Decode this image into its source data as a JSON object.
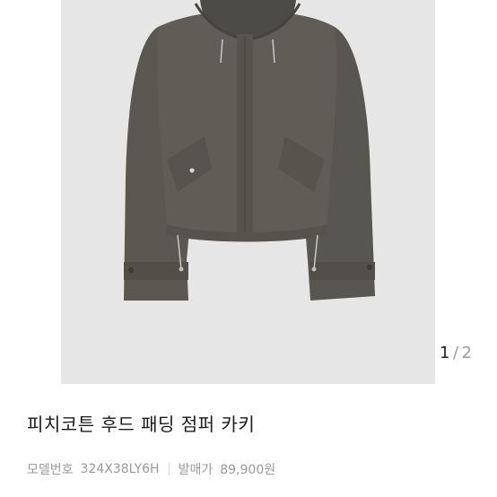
{
  "product": {
    "title": "피치코튼 후드 패딩 점퍼 카키",
    "model_label": "모델번호",
    "model_number": "324X38LY6H",
    "price_label": "발매가",
    "price": "89,900원",
    "image_subject": "khaki hooded cropped padded jacket"
  },
  "pager": {
    "current": "1",
    "separator": "/",
    "total": "2"
  },
  "colors": {
    "image_background": "#e6e6e6",
    "jacket": "#5c5a52",
    "text_primary": "#1a1a1a",
    "text_secondary": "#9a9a9a"
  }
}
